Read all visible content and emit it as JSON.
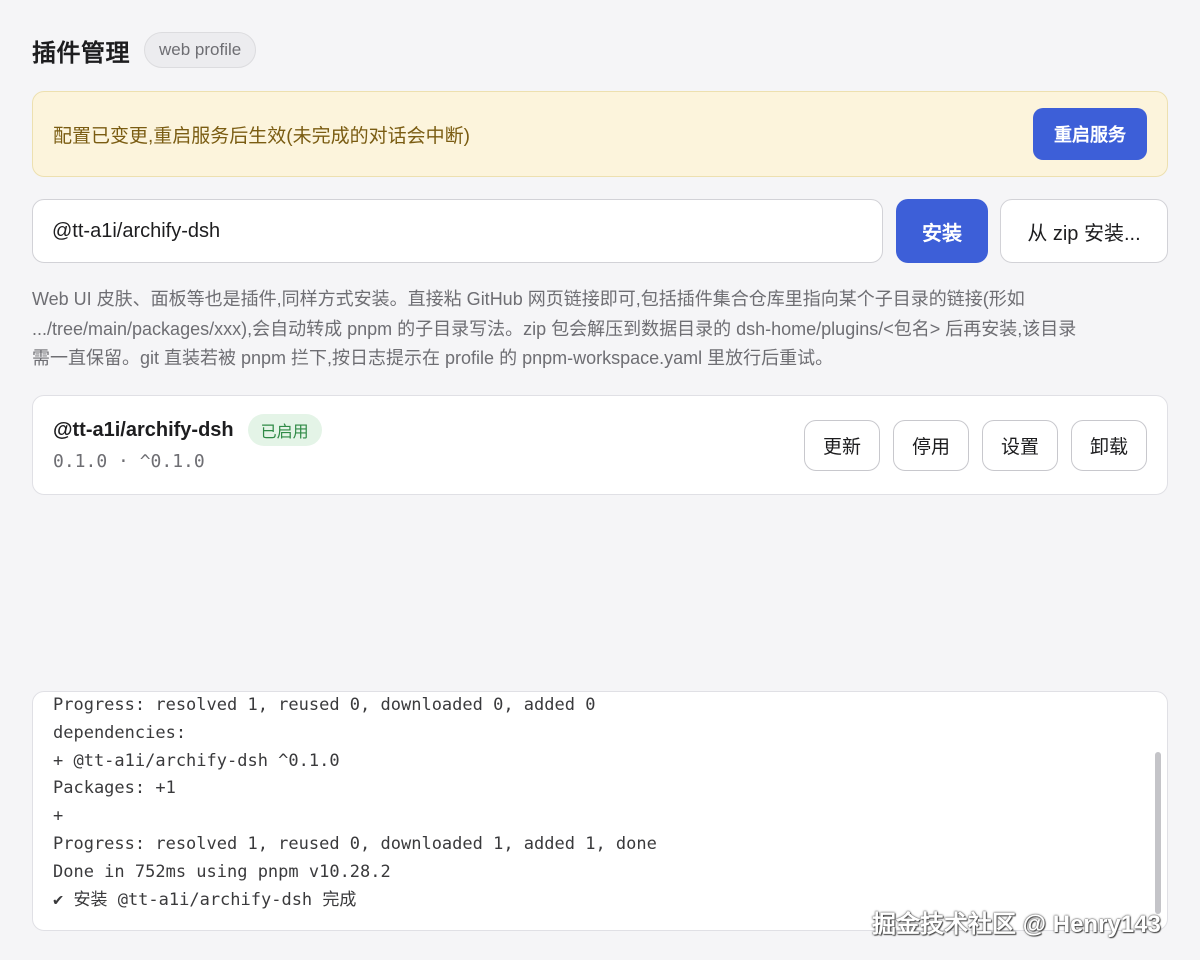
{
  "header": {
    "title": "插件管理",
    "profile_badge": "web profile"
  },
  "notice": {
    "text": "配置已变更,重启服务后生效(未完成的对话会中断)",
    "restart_label": "重启服务"
  },
  "install": {
    "input_value": "@tt-a1i/archify-dsh",
    "install_label": "安装",
    "zip_label": "从 zip 安装..."
  },
  "help": {
    "line1": "Web UI 皮肤、面板等也是插件,同样方式安装。直接粘 GitHub 网页链接即可,包括插件集合仓库里指向某个子目录的链接(形如",
    "line2": ".../tree/main/packages/xxx),会自动转成 pnpm 的子目录写法。zip 包会解压到数据目录的 dsh-home/plugins/<包名> 后再安装,该目录",
    "line3": "需一直保留。git 直装若被 pnpm 拦下,按日志提示在 profile 的 pnpm-workspace.yaml 里放行后重试。"
  },
  "plugin": {
    "name": "@tt-a1i/archify-dsh",
    "status": "已启用",
    "version": "0.1.0 · ^0.1.0",
    "actions": {
      "update": "更新",
      "disable": "停用",
      "settings": "设置",
      "uninstall": "卸载"
    }
  },
  "log": {
    "lines": [
      "Progress: resolved 1, reused 0, downloaded 0, added 0",
      "dependencies:",
      "+ @tt-a1i/archify-dsh ^0.1.0",
      "Packages: +1",
      "+",
      "Progress: resolved 1, reused 0, downloaded 1, added 1, done",
      "Done in 752ms using pnpm v10.28.2",
      "✔ 安装 @tt-a1i/archify-dsh 完成"
    ]
  },
  "watermark": "掘金技术社区 @ Henry143",
  "colors": {
    "accent": "#3d5fd8",
    "notice_bg": "#fcf4dc",
    "notice_text": "#7a5c12",
    "status_green": "#2f8a46"
  }
}
